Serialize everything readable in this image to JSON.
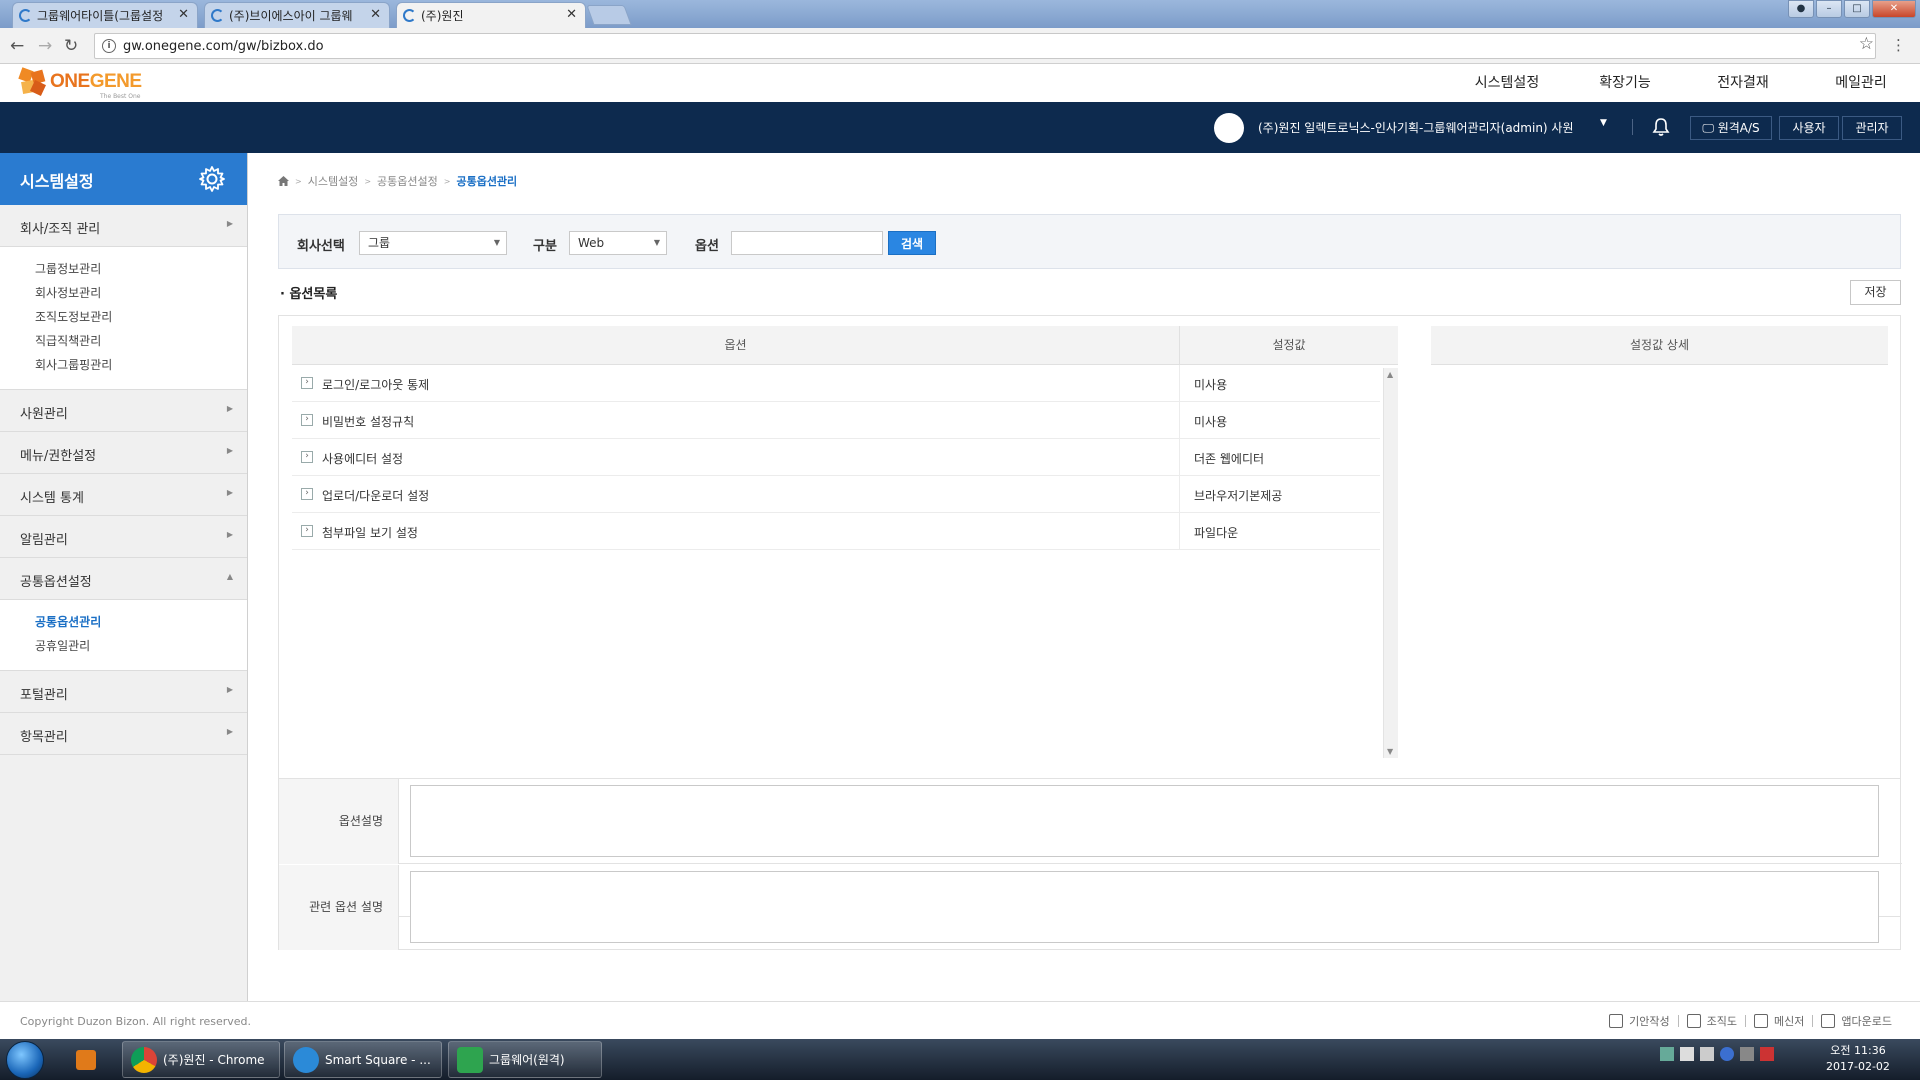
{
  "browser": {
    "tabs": [
      {
        "label": "그룹웨어타이틀(그룹설정"
      },
      {
        "label": "(주)브이에스아이 그룹웨"
      },
      {
        "label": "(주)원진"
      }
    ],
    "url": "gw.onegene.com/gw/bizbox.do"
  },
  "header": {
    "logo_one": "ONE",
    "logo_gene": "GENE",
    "logo_tagline": "The Best One",
    "menu": [
      "시스템설정",
      "확장기능",
      "전자결재",
      "메일관리"
    ],
    "user": "(주)원진 일렉트로닉스-인사기획-그룹웨어관리자(admin) 사원",
    "remote_as": "원격A/S",
    "user_mode": "사용자",
    "admin_mode": "관리자"
  },
  "sidebar": {
    "title": "시스템설정",
    "menus": [
      {
        "label": "회사/조직 관리",
        "sub": [
          "그룹정보관리",
          "회사정보관리",
          "조직도정보관리",
          "직급직책관리",
          "회사그룹핑관리"
        ]
      },
      {
        "label": "사원관리"
      },
      {
        "label": "메뉴/권한설정"
      },
      {
        "label": "시스템 통계"
      },
      {
        "label": "알림관리"
      },
      {
        "label": "공통옵션설정",
        "sub": [
          "공통옵션관리",
          "공휴일관리"
        ]
      },
      {
        "label": "포털관리"
      },
      {
        "label": "항목관리"
      }
    ],
    "active_sub": "공통옵션관리"
  },
  "breadcrumb": [
    "시스템설정",
    "공통옵션설정",
    "공통옵션관리"
  ],
  "search": {
    "company_label": "회사선택",
    "company_value": "그룹",
    "type_label": "구분",
    "type_value": "Web",
    "option_label": "옵션",
    "option_value": "",
    "search_button": "검색"
  },
  "option_list": {
    "title": "옵션목록",
    "save_button": "저장",
    "col_option": "옵션",
    "col_value": "설정값",
    "col_detail": "설정값 상세",
    "rows": [
      {
        "option": "로그인/로그아웃 통제",
        "value": "미사용"
      },
      {
        "option": "비밀번호 설정규칙",
        "value": "미사용"
      },
      {
        "option": "사용에디터 설정",
        "value": "더존 웹에디터"
      },
      {
        "option": "업로더/다운로더 설정",
        "value": "브라우저기본제공"
      },
      {
        "option": "첨부파일 보기 설정",
        "value": "파일다운"
      }
    ]
  },
  "description": {
    "option_desc_label": "옵션설명",
    "related_desc_label": "관련 옵션 설명"
  },
  "footer": {
    "copyright": "Copyright Duzon Bizon. All right reserved.",
    "tools": [
      "기안작성",
      "조직도",
      "메신저",
      "앱다운로드"
    ]
  },
  "taskbar": {
    "items": [
      "(주)원진 - Chrome",
      "Smart Square - ...",
      "그룹웨어(원격)"
    ],
    "time": "오전 11:36",
    "date": "2017-02-02"
  },
  "colors": {
    "app_bar": "#0d2a4e",
    "sidebar_head": "#2a7bd0",
    "accent": "#1a6fc5",
    "search_button": "#2a86e2"
  }
}
